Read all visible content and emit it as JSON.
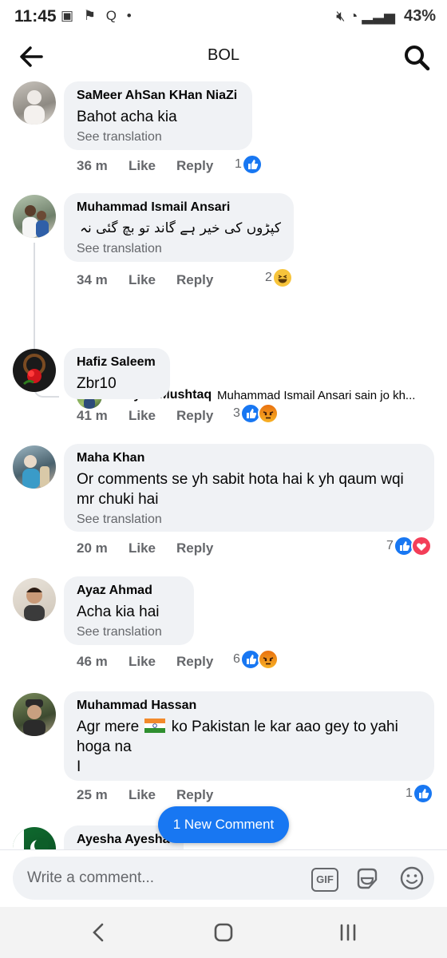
{
  "status_bar": {
    "time": "11:45",
    "battery": "43%"
  },
  "header": {
    "title": "BOL"
  },
  "comments": [
    {
      "name": "SaMeer AhSan KHan NiaZi",
      "text": "Bahot acha kia",
      "see_translation": "See translation",
      "time": "36 m",
      "like": "Like",
      "reply": "Reply",
      "reaction_count": "1"
    },
    {
      "name": "Muhammad Ismail Ansari",
      "text": "کپڑوں کی خیر ہے گاند تو بچ گئی نہ",
      "see_translation": "See translation",
      "time": "34 m",
      "like": "Like",
      "reply": "Reply",
      "reaction_count": "2"
    },
    {
      "name": "Hafiz Saleem",
      "text": "Zbr10",
      "time": "41 m",
      "like": "Like",
      "reply": "Reply",
      "reaction_count": "3"
    },
    {
      "name": "Maha Khan",
      "text": "Or comments se yh sabit hota hai k yh qaum wqi mr chuki hai",
      "see_translation": "See translation",
      "time": "20 m",
      "like": "Like",
      "reply": "Reply",
      "reaction_count": "7"
    },
    {
      "name": "Ayaz Ahmad",
      "text": "Acha kia hai",
      "see_translation": "See translation",
      "time": "46 m",
      "like": "Like",
      "reply": "Reply",
      "reaction_count": "6"
    },
    {
      "name": "Muhammad Hassan",
      "text_before_flag": "Agr mere",
      "text_after_flag": "ko Pakistan le kar aao gey to yahi hoga na",
      "text_line3": "I",
      "time": "25 m",
      "like": "Like",
      "reply": "Reply",
      "reaction_count": "1"
    },
    {
      "name": "Ayesha Ayesha"
    }
  ],
  "reply_preview": {
    "name": "Shayan Mushtaq",
    "text": "Muhammad Ismail Ansari sain jo kh..."
  },
  "new_comment_button": "1 New Comment",
  "composer": {
    "placeholder": "Write a comment...",
    "gif_label": "GIF"
  },
  "colors": {
    "accent": "#1877f2",
    "bubble": "#f0f2f5",
    "secondary_text": "#65676b"
  }
}
